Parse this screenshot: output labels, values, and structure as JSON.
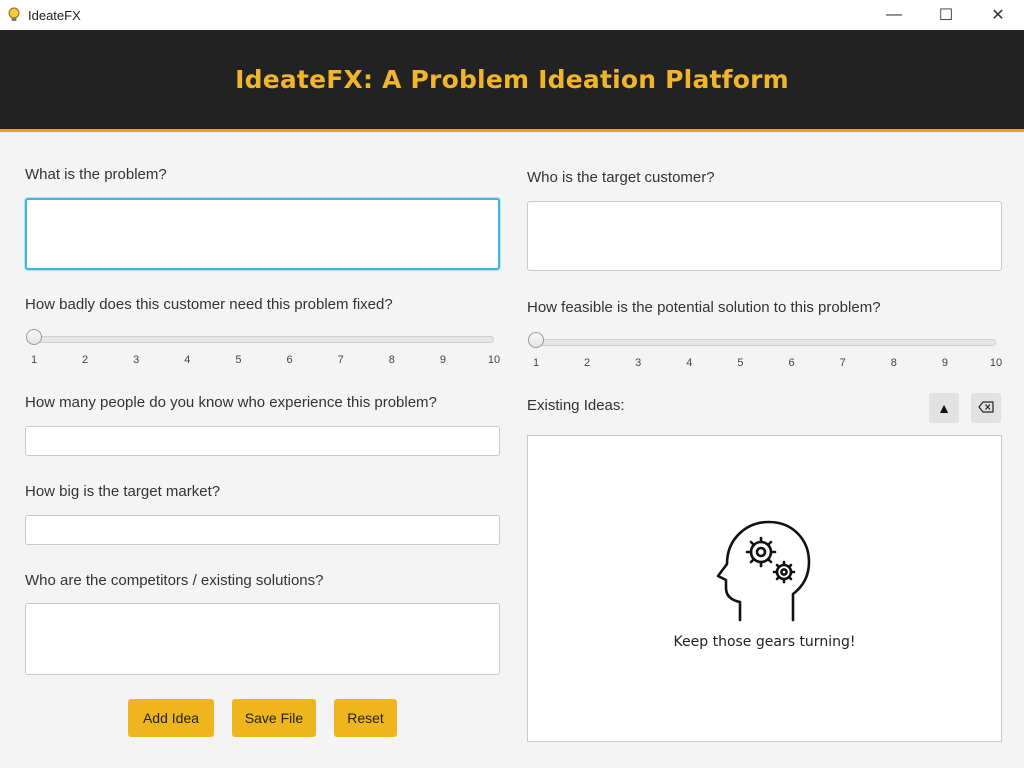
{
  "window": {
    "title": "IdeateFX",
    "app_icon": "lightbulb-icon",
    "controls": {
      "minimize": "—",
      "maximize": "☐",
      "close": "✕"
    }
  },
  "header": {
    "title": "IdeateFX: A Problem Ideation Platform",
    "accent_color": "#f0b52a",
    "background": "#222222"
  },
  "left": {
    "problem_label": "What is the problem?",
    "problem_value": "",
    "need_label": "How badly does this customer need this problem fixed?",
    "need_slider": {
      "min": 1,
      "max": 10,
      "value": 1,
      "ticks": [
        "1",
        "2",
        "3",
        "4",
        "5",
        "6",
        "7",
        "8",
        "9",
        "10"
      ]
    },
    "people_label": "How many people do you know who experience this problem?",
    "people_value": "",
    "market_label": "How big is the target market?",
    "market_value": "",
    "competitors_label": "Who are the competitors / existing solutions?",
    "competitors_value": ""
  },
  "right": {
    "customer_label": "Who is the target customer?",
    "customer_value": "",
    "feasible_label": "How feasible is the potential solution to this problem?",
    "feasible_slider": {
      "min": 1,
      "max": 10,
      "value": 1,
      "ticks": [
        "1",
        "2",
        "3",
        "4",
        "5",
        "6",
        "7",
        "8",
        "9",
        "10"
      ]
    },
    "ideas_label": "Existing Ideas:",
    "sort_icon": "triangle-up-icon",
    "sort_glyph": "▲",
    "clear_icon": "eraser-icon",
    "empty_message": "Keep those gears turning!",
    "empty_icon": "head-gears-icon"
  },
  "actions": {
    "add": "Add Idea",
    "save": "Save File",
    "reset": "Reset",
    "button_color": "#efb51e"
  }
}
